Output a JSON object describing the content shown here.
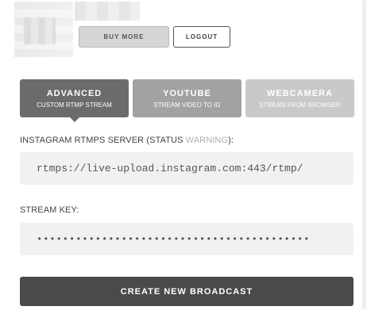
{
  "header": {
    "buy_more_label": "BUY MORE",
    "logout_label": "LOGOUT"
  },
  "tabs": [
    {
      "title": "ADVANCED",
      "subtitle": "CUSTOM RTMP STREAM",
      "active": true
    },
    {
      "title": "YOUTUBE",
      "subtitle": "STREAM VIDEO TO IG",
      "active": false
    },
    {
      "title": "WEBCAMERA",
      "subtitle": "STREAM FROM BROWSER",
      "active": false
    }
  ],
  "server": {
    "label_prefix": "INSTAGRAM RTMPS SERVER (STATUS ",
    "status": "WARNING",
    "label_suffix": "):",
    "value": "rtmps://live-upload.instagram.com:443/rtmp/"
  },
  "stream_key": {
    "label": "STREAM KEY:",
    "value": "••••••••••••••••••••••••••••••••••••••••••"
  },
  "create_button_label": "CREATE NEW BROADCAST",
  "colors": {
    "tab_active": "#6b6b6b",
    "tab_youtube": "#a2a2a2",
    "tab_webcam": "#c9c9c9",
    "primary_button": "#4a4a4a",
    "warning_text": "#b0b0b0"
  }
}
